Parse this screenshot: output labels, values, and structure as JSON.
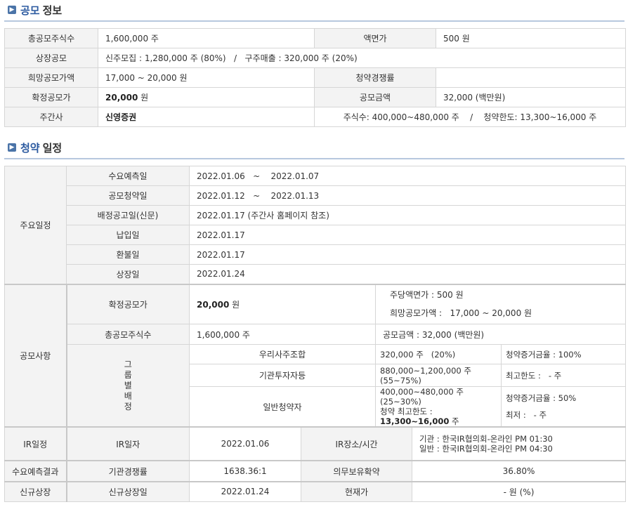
{
  "sections": {
    "offering": {
      "highlight": "공모",
      "rest": "정보"
    },
    "schedule": {
      "highlight": "청약",
      "rest": "일정"
    }
  },
  "offering": {
    "total_shares_label": "총공모주식수",
    "total_shares": "1,600,000 주",
    "face_value_label": "액면가",
    "face_value": "500 원",
    "listing_offer_label": "상장공모",
    "listing_offer": "신주모집 : 1,280,000 주 (80%)   /   구주매출 : 320,000 주 (20%)",
    "hope_price_label": "희망공모가액",
    "hope_price": "17,000 ~ 20,000 원",
    "competition_label": "청약경쟁률",
    "competition": "",
    "final_price_label": "확정공모가",
    "final_price_num": "20,000",
    "final_price_unit": " 원",
    "amount_label": "공모금액",
    "amount": "32,000 (백만원)",
    "underwriter_label": "주간사",
    "underwriter": "신영증권",
    "underwriter_info": "주식수: 400,000~480,000 주    /    청약한도: 13,300~16,000 주"
  },
  "schedule": {
    "main_label": "주요일정",
    "rows": [
      {
        "label": "수요예측일",
        "value": "2022.01.06   ~    2022.01.07"
      },
      {
        "label": "공모청약일",
        "value": "2022.01.12   ~    2022.01.13"
      },
      {
        "label": "배정공고일(신문)",
        "value": "2022.01.17 (주간사 홈페이지 참조)"
      },
      {
        "label": "납입일",
        "value": "2022.01.17"
      },
      {
        "label": "환불일",
        "value": "2022.01.17"
      },
      {
        "label": "상장일",
        "value": "2022.01.24"
      }
    ],
    "offer_label": "공모사항",
    "final_price_label": "확정공모가",
    "final_price_num": "20,000",
    "final_price_unit": " 원",
    "face_value_text": "주당액면가 :   500 원",
    "hope_price_text": "희망공모가액 :   17,000 ~ 20,000 원",
    "total_shares_label": "총공모주식수",
    "total_shares": "1,600,000 주",
    "amount_text": "공모금액 : 32,000 (백만원)",
    "group_label": "그룹별배정",
    "groups": [
      {
        "name": "우리사주조합",
        "shares": "320,000 주   (20%)",
        "note": "청약증거금율 : 100%"
      },
      {
        "name": "기관투자자등",
        "shares_line1": "880,000~1,200,000 주",
        "shares_line2": "(55~75%)",
        "note": "최고한도 :   - 주"
      },
      {
        "name": "일반청약자",
        "shares_line1": "400,000~480,000 주",
        "shares_line2": "(25~30%)",
        "note": "청약증거금율 : 50%",
        "limit_label": "청약 최고한도 :",
        "limit_value": "13,300~16,000",
        "limit_unit": " 주",
        "min_note": "최저 :   - 주"
      }
    ],
    "ir": {
      "label": "IR일정",
      "date_label": "IR일자",
      "date": "2022.01.06",
      "place_label": "IR장소/시간",
      "place_line1": "기관 : 한국IR협의회-온라인 PM 01:30",
      "place_line2": "일반 : 한국IR협의회-온라인 PM 04:30"
    },
    "demand": {
      "label": "수요예측결과",
      "comp_label": "기관경쟁률",
      "comp": "1638.36:1",
      "lock_label": "의무보유확약",
      "lock": "36.80%"
    },
    "listing": {
      "label": "신규상장",
      "date_label": "신규상장일",
      "date": "2022.01.24",
      "price_label": "현재가",
      "price": "- 원 (%)"
    }
  }
}
